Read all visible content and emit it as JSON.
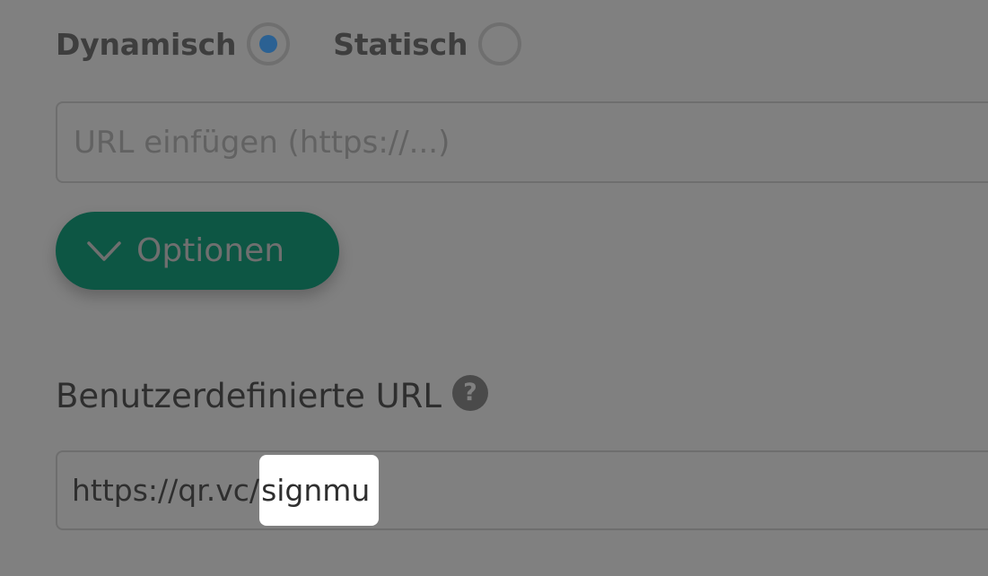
{
  "qr_type": {
    "dynamic_label": "Dynamisch",
    "static_label": "Statisch",
    "selected": "Dynamisch",
    "selected_color": "#2b6193"
  },
  "url_input": {
    "placeholder": "URL einfügen (https://...)",
    "value": ""
  },
  "options_button": {
    "label": "Optionen",
    "icon": "chevron-down-icon",
    "color": "#0d5644"
  },
  "custom_url": {
    "label": "Benutzerdefinierte URL",
    "help_icon": "help-icon",
    "prefix": "https://qr.vc/",
    "slug": "signmu"
  }
}
